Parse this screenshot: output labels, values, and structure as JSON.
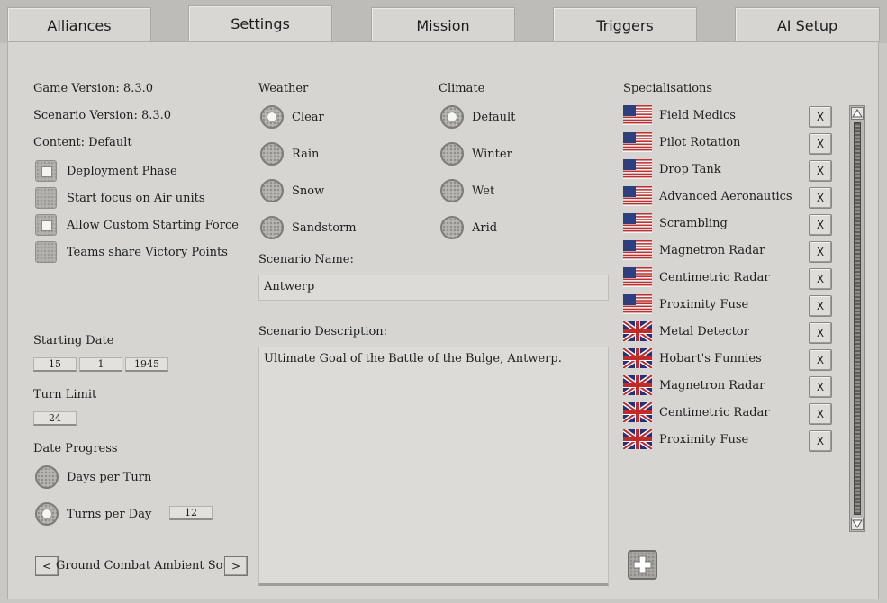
{
  "tabs": [
    {
      "label": "Alliances"
    },
    {
      "label": "Settings"
    },
    {
      "label": "Mission"
    },
    {
      "label": "Triggers"
    },
    {
      "label": "AI Setup"
    }
  ],
  "info": {
    "game_version": "Game Version: 8.3.0",
    "scenario_version": "Scenario Version: 8.3.0",
    "content": "Content: Default"
  },
  "options": [
    {
      "label": "Deployment Phase",
      "checked": true
    },
    {
      "label": "Start focus on Air units",
      "checked": false
    },
    {
      "label": "Allow Custom Starting Force",
      "checked": true
    },
    {
      "label": "Teams share Victory Points",
      "checked": false
    }
  ],
  "starting_date": {
    "label": "Starting Date",
    "day": "15",
    "month": "1",
    "year": "1945"
  },
  "turn_limit": {
    "label": "Turn Limit",
    "value": "24"
  },
  "date_progress": {
    "label": "Date Progress",
    "days_per_turn": "Days per Turn",
    "turns_per_day": "Turns per Day",
    "turns_value": "12"
  },
  "sound": {
    "label": "Ground Combat Ambient Sound",
    "prev": "<",
    "next": ">"
  },
  "weather": {
    "label": "Weather",
    "options": [
      "Clear",
      "Rain",
      "Snow",
      "Sandstorm"
    ],
    "selected": "Clear"
  },
  "climate": {
    "label": "Climate",
    "options": [
      "Default",
      "Winter",
      "Wet",
      "Arid"
    ],
    "selected": "Default"
  },
  "scenario_name": {
    "label": "Scenario Name:",
    "value": "Antwerp"
  },
  "scenario_description": {
    "label": "Scenario Description:",
    "value": "Ultimate Goal of the Battle of the Bulge, Antwerp."
  },
  "specialisations": {
    "label": "Specialisations",
    "remove_label": "X",
    "items": [
      {
        "name": "Field Medics",
        "flag": "us"
      },
      {
        "name": "Pilot Rotation",
        "flag": "us"
      },
      {
        "name": "Drop Tank",
        "flag": "us"
      },
      {
        "name": "Advanced Aeronautics",
        "flag": "us"
      },
      {
        "name": "Scrambling",
        "flag": "us"
      },
      {
        "name": "Magnetron Radar",
        "flag": "us"
      },
      {
        "name": "Centimetric Radar",
        "flag": "us"
      },
      {
        "name": "Proximity Fuse",
        "flag": "us"
      },
      {
        "name": "Metal Detector",
        "flag": "uk"
      },
      {
        "name": "Hobart's Funnies",
        "flag": "uk"
      },
      {
        "name": "Magnetron Radar",
        "flag": "uk"
      },
      {
        "name": "Centimetric Radar",
        "flag": "uk"
      },
      {
        "name": "Proximity Fuse",
        "flag": "uk"
      }
    ]
  },
  "icons": {
    "add": "plus-icon",
    "scroll_up": "triangle-up-icon",
    "scroll_down": "triangle-down-icon"
  }
}
